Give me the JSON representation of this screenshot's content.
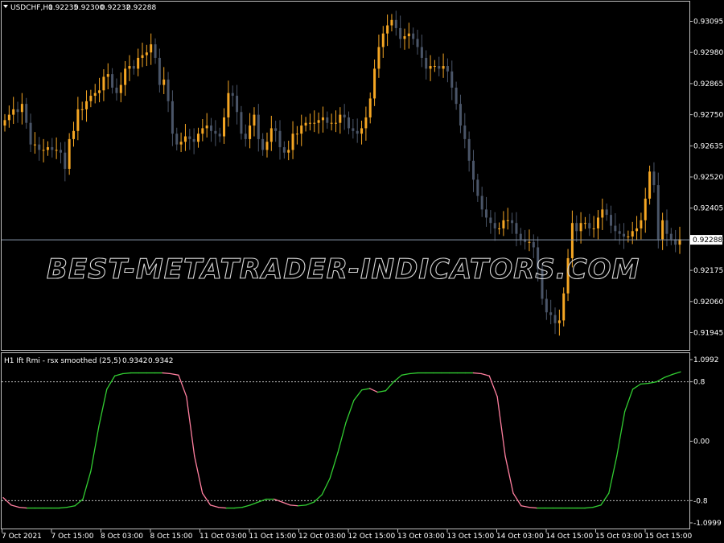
{
  "main_pane": {
    "dropdown_icon": "triangle-down-icon",
    "symbol": "USDCHF,H1",
    "ohlc": [
      "0.92235",
      "0.92300",
      "0.92232",
      "0.92288"
    ],
    "current_price": "0.92288",
    "price_ticks": [
      "0.93095",
      "0.92980",
      "0.92865",
      "0.92750",
      "0.92635",
      "0.92520",
      "0.92405",
      "0.92288",
      "0.92175",
      "0.92060",
      "0.91945"
    ],
    "watermark": "BEST-METATRADER-INDICATORS.COM"
  },
  "indicator_pane": {
    "title": "H1 Ift Rmi - rsx smoothed (25,5)",
    "values": [
      "0.9342",
      "0.9342"
    ],
    "ticks": [
      "1.0992",
      "0.8",
      "0.00",
      "-0.8",
      "-1.0999"
    ]
  },
  "time_axis": [
    "7 Oct 2021",
    "7 Oct 15:00",
    "8 Oct 03:00",
    "8 Oct 15:00",
    "11 Oct 03:00",
    "11 Oct 15:00",
    "12 Oct 03:00",
    "12 Oct 15:00",
    "13 Oct 03:00",
    "13 Oct 15:00",
    "14 Oct 03:00",
    "14 Oct 15:00",
    "15 Oct 03:00",
    "15 Oct 15:00"
  ],
  "colors": {
    "background": "#000000",
    "frame": "#c0c0c0",
    "bull_candle": "#f5a623",
    "bear_candle": "#4a5568",
    "indicator_up": "#32cd32",
    "indicator_down": "#ff7f9f",
    "level_line": "#c0c0c0",
    "price_line": "#8c9bb0"
  },
  "chart_data": [
    {
      "type": "candlestick",
      "symbol": "USDCHF",
      "timeframe": "H1",
      "ylim": [
        0.9189,
        0.9315
      ],
      "price_line": 0.92288,
      "closes": [
        0.9273,
        0.9275,
        0.9277,
        0.9276,
        0.9279,
        0.9272,
        0.9264,
        0.9264,
        0.9262,
        0.9262,
        0.9263,
        0.9262,
        0.9262,
        0.9261,
        0.9255,
        0.9266,
        0.9269,
        0.9277,
        0.9277,
        0.928,
        0.9282,
        0.9283,
        0.9284,
        0.9289,
        0.929,
        0.9285,
        0.9283,
        0.9286,
        0.9292,
        0.9293,
        0.9292,
        0.9296,
        0.9297,
        0.9298,
        0.9301,
        0.9296,
        0.9286,
        0.9288,
        0.928,
        0.9268,
        0.9264,
        0.9265,
        0.9267,
        0.9266,
        0.9265,
        0.9268,
        0.927,
        0.9271,
        0.9269,
        0.9268,
        0.9267,
        0.9274,
        0.9283,
        0.9282,
        0.9276,
        0.9268,
        0.9266,
        0.9271,
        0.9275,
        0.9266,
        0.9262,
        0.9265,
        0.927,
        0.9269,
        0.9263,
        0.9261,
        0.9262,
        0.9268,
        0.9268,
        0.9271,
        0.9272,
        0.9272,
        0.9272,
        0.9273,
        0.9274,
        0.9272,
        0.9272,
        0.9272,
        0.9275,
        0.9274,
        0.927,
        0.9269,
        0.9268,
        0.927,
        0.9274,
        0.9281,
        0.9292,
        0.93,
        0.9305,
        0.9308,
        0.931,
        0.9307,
        0.9303,
        0.9304,
        0.9305,
        0.9303,
        0.93,
        0.9296,
        0.9292,
        0.9293,
        0.9293,
        0.9292,
        0.9293,
        0.9291,
        0.9285,
        0.9279,
        0.9271,
        0.9266,
        0.9258,
        0.9251,
        0.9245,
        0.924,
        0.9237,
        0.9235,
        0.9233,
        0.9233,
        0.9236,
        0.9236,
        0.9235,
        0.9231,
        0.9229,
        0.9228,
        0.9228,
        0.9226,
        0.9218,
        0.9207,
        0.9202,
        0.9201,
        0.9198,
        0.9199,
        0.9209,
        0.9222,
        0.9235,
        0.9232,
        0.9235,
        0.9235,
        0.9233,
        0.9233,
        0.9237,
        0.924,
        0.9238,
        0.9234,
        0.9232,
        0.9231,
        0.923,
        0.923,
        0.9232,
        0.9233,
        0.9236,
        0.9244,
        0.9254,
        0.9249,
        0.9229,
        0.9236,
        0.9231,
        0.9229,
        0.9227,
        0.9229
      ]
    },
    {
      "type": "line",
      "name": "H1 Ift Rmi - rsx smoothed (25,5)",
      "ylim": [
        -1.0999,
        1.0992
      ],
      "levels": [
        0.8,
        -0.8
      ],
      "x": [
        0,
        2,
        4,
        6,
        8,
        10,
        12,
        14,
        16,
        18,
        20,
        22,
        24,
        26,
        28,
        30,
        32,
        34,
        36,
        38,
        40,
        42,
        44,
        46,
        48,
        50,
        52,
        54,
        56,
        58,
        60,
        62,
        64,
        66,
        68,
        70,
        72,
        74,
        76,
        78,
        80,
        82,
        84,
        86,
        88,
        90,
        92,
        94,
        96,
        98,
        100,
        102,
        104,
        106,
        108,
        110,
        112,
        114,
        116,
        118,
        120,
        122,
        124,
        126,
        128,
        130,
        132,
        134,
        136,
        138,
        140,
        142,
        144,
        146,
        148,
        150,
        152,
        154,
        156,
        158,
        160,
        162,
        164,
        166,
        168,
        170
      ],
      "values": [
        -0.76,
        -0.86,
        -0.89,
        -0.9,
        -0.9,
        -0.9,
        -0.9,
        -0.9,
        -0.89,
        -0.87,
        -0.78,
        -0.4,
        0.2,
        0.7,
        0.88,
        0.91,
        0.92,
        0.92,
        0.92,
        0.92,
        0.92,
        0.91,
        0.89,
        0.6,
        -0.2,
        -0.7,
        -0.86,
        -0.89,
        -0.9,
        -0.9,
        -0.89,
        -0.86,
        -0.82,
        -0.78,
        -0.78,
        -0.82,
        -0.86,
        -0.87,
        -0.86,
        -0.82,
        -0.72,
        -0.5,
        -0.15,
        0.25,
        0.55,
        0.69,
        0.71,
        0.66,
        0.68,
        0.8,
        0.89,
        0.91,
        0.92,
        0.92,
        0.92,
        0.92,
        0.92,
        0.92,
        0.92,
        0.92,
        0.91,
        0.88,
        0.6,
        -0.2,
        -0.7,
        -0.87,
        -0.89,
        -0.9,
        -0.9,
        -0.9,
        -0.9,
        -0.9,
        -0.9,
        -0.9,
        -0.89,
        -0.86,
        -0.7,
        -0.2,
        0.4,
        0.7,
        0.77,
        0.78,
        0.8,
        0.86,
        0.9,
        0.9342
      ]
    }
  ]
}
